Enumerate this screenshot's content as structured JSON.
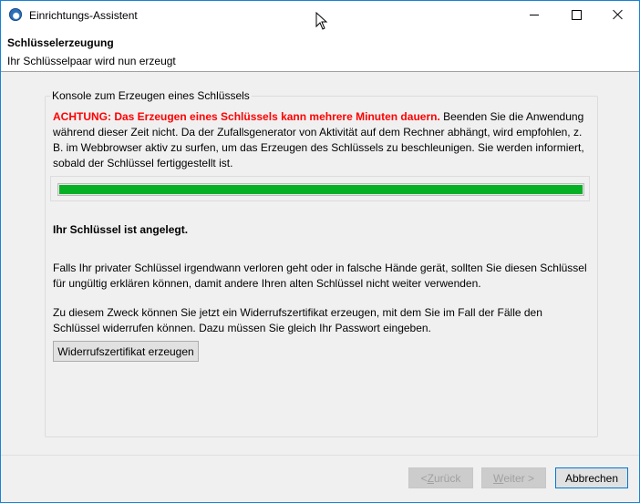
{
  "window": {
    "title": "Einrichtungs-Assistent"
  },
  "header": {
    "title": "Schlüsselerzeugung",
    "subtitle": "Ihr Schlüsselpaar wird nun erzeugt"
  },
  "console": {
    "legend": "Konsole zum Erzeugen eines Schlüssels",
    "warning_strong": "ACHTUNG: Das Erzeugen eines Schlüssels kann mehrere Minuten dauern.",
    "warning_rest": " Beenden Sie die Anwendung während dieser Zeit nicht. Da der Zufallsgenerator von Aktivität auf dem Rechner abhängt, wird empfohlen, z. B. im Webbrowser aktiv zu surfen, um das Erzeugen des Schlüssels zu beschleunigen. Sie werden informiert, sobald der Schlüssel fertiggestellt ist.",
    "progress_percent": 100,
    "key_created": "Ihr Schlüssel ist angelegt.",
    "para1": "Falls Ihr privater Schlüssel irgendwann verloren geht oder in falsche Hände gerät, sollten Sie diesen Schlüssel für ungültig erklären können, damit andere Ihren alten Schlüssel nicht weiter verwenden.",
    "para2": "Zu diesem Zweck können Sie jetzt ein Widerrufszertifikat erzeugen, mit dem Sie im Fall der Fälle den Schlüssel widerrufen können. Dazu müssen Sie gleich Ihr Passwort eingeben.",
    "revoke_button": "Widerrufszertifikat erzeugen"
  },
  "footer": {
    "back_prefix": "< ",
    "back_accel": "Z",
    "back_rest": "urück",
    "next_accel": "W",
    "next_rest": "eiter >",
    "cancel": "Abbrechen"
  },
  "colors": {
    "progress_fill": "#06b025",
    "warning": "#ff0000"
  }
}
